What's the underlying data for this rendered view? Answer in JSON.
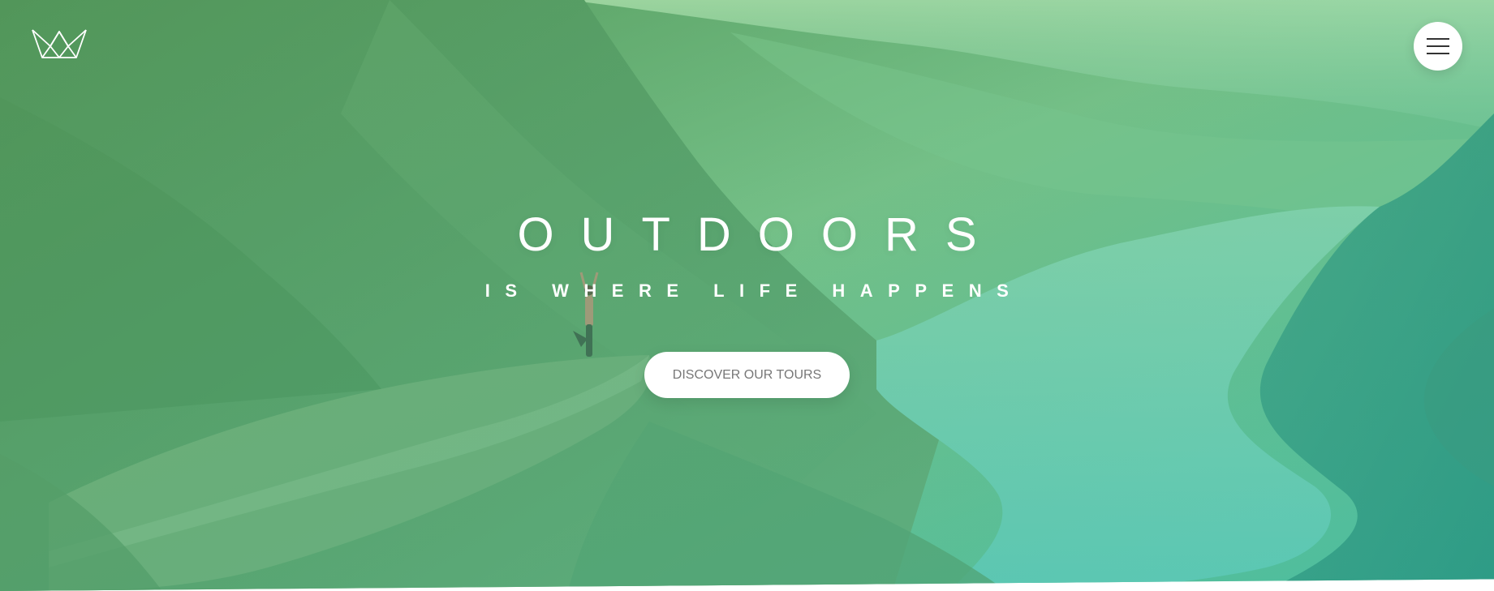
{
  "hero": {
    "title": "OUTDOORS",
    "subtitle": "IS WHERE LIFE HAPPENS",
    "cta_label": "DISCOVER OUR TOURS",
    "background": "green-tinted mountain fjord photo with a person doing a yoga pose on a rock ledge"
  },
  "header": {
    "logo_icon": "crown-logo-icon",
    "menu_icon": "hamburger-menu-icon"
  },
  "colors": {
    "overlay_start": "#5aa95f",
    "overlay_end": "#2fb39a",
    "text": "#ffffff",
    "button_bg": "#ffffff",
    "button_text": "#777777"
  }
}
